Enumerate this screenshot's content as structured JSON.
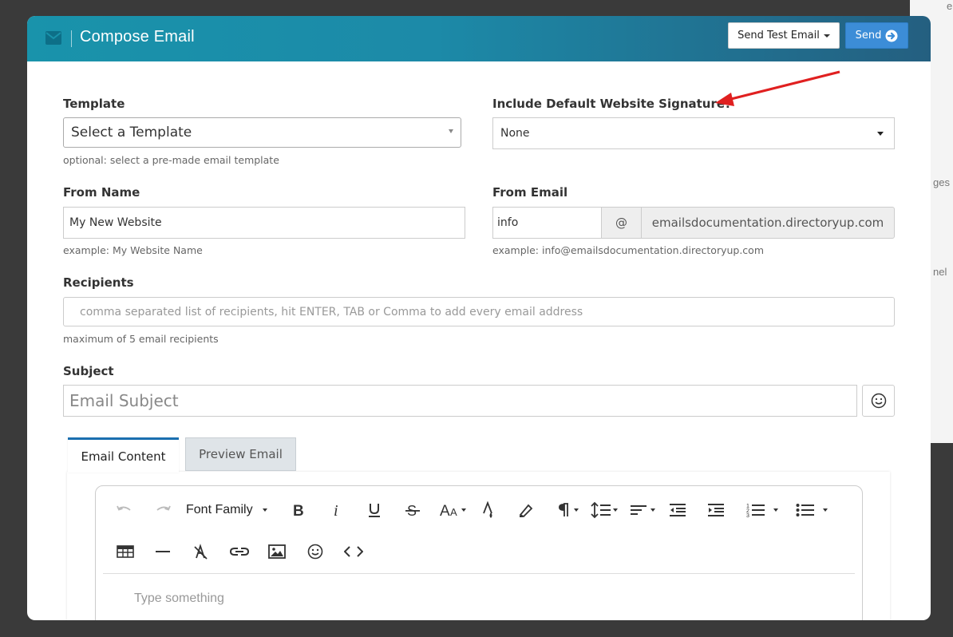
{
  "backdrop": {
    "right_text_1": "ges",
    "right_text_2": "nel",
    "top_right_glyph": "e"
  },
  "header": {
    "icon": "envelope-icon",
    "title": "Compose Email",
    "send_test_label": "Send Test Email",
    "send_label": "Send",
    "send_icon": "arrow-circle-right-icon"
  },
  "form": {
    "template": {
      "label": "Template",
      "value": "Select a Template",
      "help": "optional: select a pre-made email template"
    },
    "signature": {
      "label": "Include Default Website Signature?",
      "value": "None"
    },
    "from_name": {
      "label": "From Name",
      "value": "My New Website",
      "help": "example: My Website Name"
    },
    "from_email": {
      "label": "From Email",
      "local": "info",
      "at": "@",
      "domain": "emailsdocumentation.directoryup.com",
      "help": "example: info@emailsdocumentation.directoryup.com"
    },
    "recipients": {
      "label": "Recipients",
      "placeholder": "comma separated list of recipients, hit ENTER, TAB or Comma to add every email address",
      "help": "maximum of 5 email recipients"
    },
    "subject": {
      "label": "Subject",
      "placeholder": "Email Subject",
      "emoji_icon": "smiley-icon"
    }
  },
  "tabs": [
    {
      "label": "Email Content",
      "active": true
    },
    {
      "label": "Preview Email",
      "active": false
    }
  ],
  "editor": {
    "font_family_label": "Font Family",
    "placeholder": "Type something",
    "toolbar_icons": [
      "undo-icon",
      "redo-icon",
      "bold-icon",
      "italic-icon",
      "underline-icon",
      "strikethrough-icon",
      "font-size-icon",
      "text-color-icon",
      "background-color-icon",
      "paragraph-format-icon",
      "line-height-icon",
      "align-icon",
      "outdent-icon",
      "indent-icon",
      "ordered-list-icon",
      "unordered-list-icon",
      "table-icon",
      "horizontal-line-icon",
      "clear-formatting-icon",
      "link-icon",
      "image-icon",
      "emoticon-icon",
      "code-view-icon"
    ]
  },
  "annotation": {
    "arrow_color": "#e02020"
  },
  "colors": {
    "header_start": "#1993ab",
    "header_end": "#245f80",
    "send_button": "#3c8dd7"
  }
}
